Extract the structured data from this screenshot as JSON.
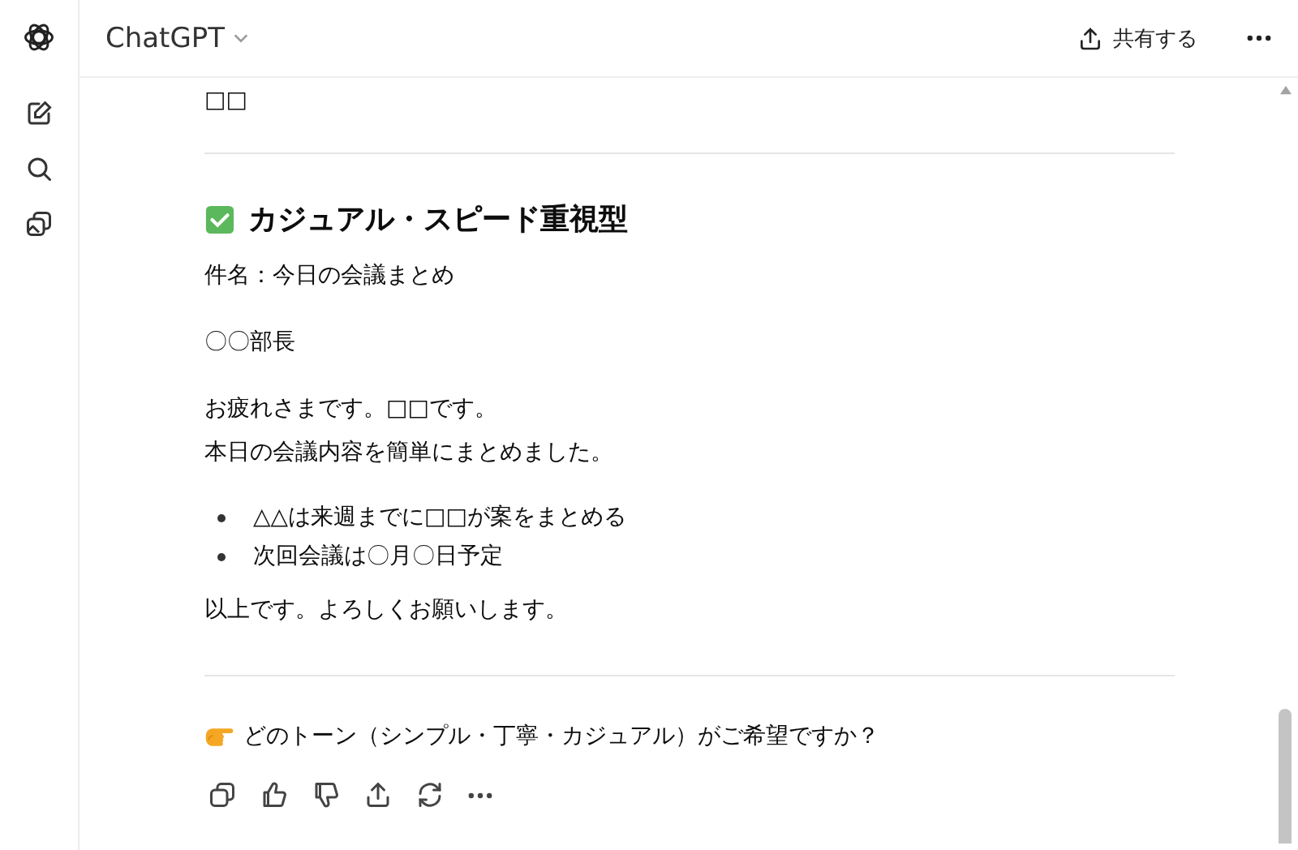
{
  "header": {
    "model": "ChatGPT",
    "share": "共有する"
  },
  "message": {
    "top_fragment": "□□",
    "heading": "カジュアル・スピード重視型",
    "blocks": [
      {
        "kind": "para",
        "lines": [
          "件名：今日の会議まとめ"
        ]
      },
      {
        "kind": "para",
        "lines": [
          "〇〇部長"
        ]
      },
      {
        "kind": "para",
        "lines": [
          "お疲れさまです。□□です。",
          "本日の会議内容を簡単にまとめました。"
        ]
      },
      {
        "kind": "list",
        "lines": [
          "△△は来週までに□□が案をまとめる",
          "次回会議は〇月〇日予定"
        ]
      },
      {
        "kind": "para",
        "lines": [
          "以上です。よろしくお願いします。"
        ]
      }
    ],
    "question": "どのトーン（シンプル・丁寧・カジュアル）がご希望ですか？"
  }
}
